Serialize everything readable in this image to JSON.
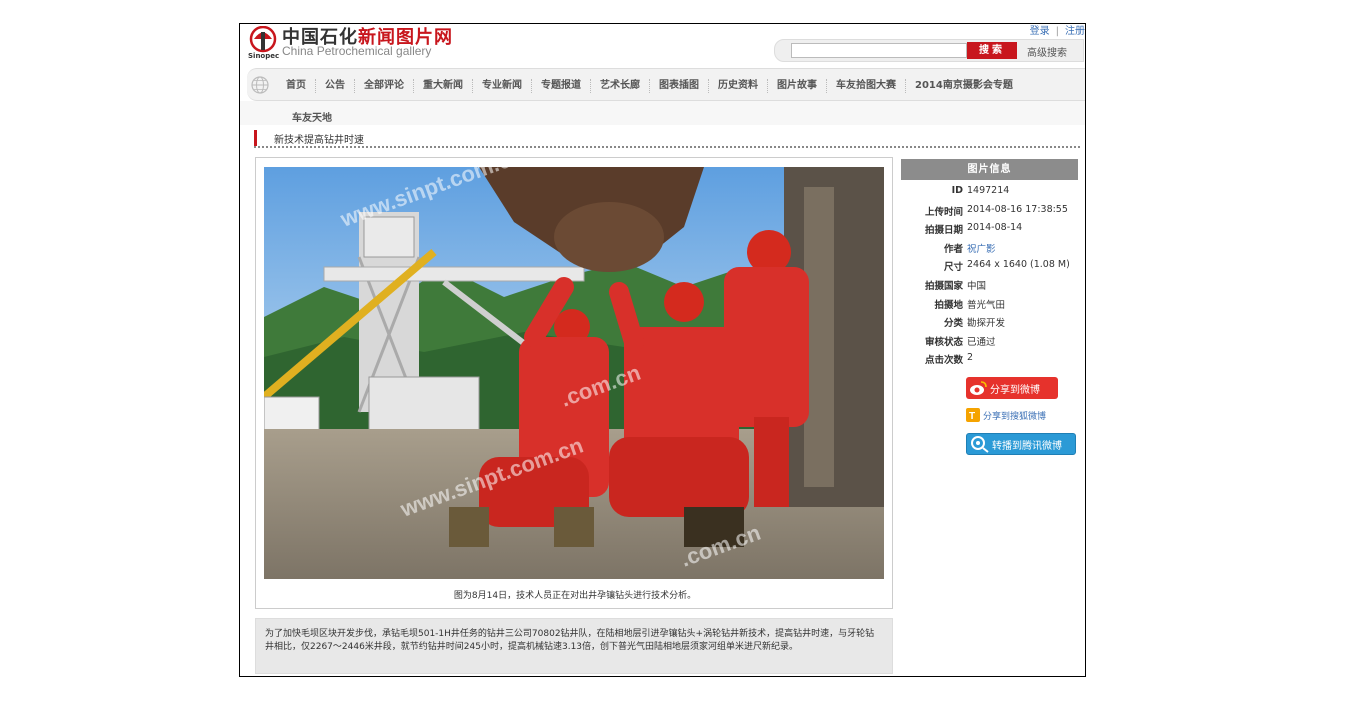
{
  "header": {
    "logo_title_a": "中国石化",
    "logo_title_b": "新闻图片网",
    "logo_sub": "China Petrochemical gallery",
    "logo_brand": "Sinopec",
    "login": "登录",
    "separator": "|",
    "register": "注册",
    "search_placeholder": "",
    "search_button": "搜索",
    "advanced_search": "高级搜索"
  },
  "nav": {
    "items": [
      "首页",
      "公告",
      "全部评论",
      "重大新闻",
      "专业新闻",
      "专题报道",
      "艺术长廊",
      "图表插图",
      "历史资料",
      "图片故事",
      "车友拾图大赛",
      "2014南京摄影会专题"
    ],
    "extra": "车友天地"
  },
  "breadcrumb": "新技术提高钻井时速",
  "photo": {
    "caption": "图为8月14日，技术人员正在对出井孕镶钻头进行技术分析。",
    "watermark": "www.sinpt.com.cn"
  },
  "description": "为了加快毛坝区块开发步伐，承钻毛坝501-1H井任务的钻井三公司70802钻井队，在陆相地层引进孕镶钻头+涡轮钻井新技术，提高钻井时速，与牙轮钻井相比，仅2267～2446米井段，就节约钻井时间245小时，提高机械钻速3.13倍，创下普光气田陆相地层须家河组单米进尺新纪录。",
  "info": {
    "title": "图片信息",
    "rows": [
      {
        "label": "ID",
        "value": "1497214"
      },
      {
        "label": "上传时间",
        "value": "2014-08-16 17:38:55"
      },
      {
        "label": "拍摄日期",
        "value": "2014-08-14"
      },
      {
        "label": "作者",
        "value": "祝广影"
      },
      {
        "label": "尺寸",
        "value": "2464 x 1640 (1.08 M)"
      },
      {
        "label": "拍摄国家",
        "value": "中国"
      },
      {
        "label": "拍摄地",
        "value": "普光气田"
      },
      {
        "label": "分类",
        "value": "勘探开发"
      },
      {
        "label": "审核状态",
        "value": "已通过"
      },
      {
        "label": "点击次数",
        "value": "2"
      }
    ]
  },
  "share": {
    "weibo": "分享到微博",
    "sohu": "分享到搜狐微博",
    "qq": "转播到腾讯微博"
  },
  "colors": {
    "brand_red": "#c8161d",
    "link_blue": "#3a6fb5",
    "info_header": "#8c8c8c"
  }
}
